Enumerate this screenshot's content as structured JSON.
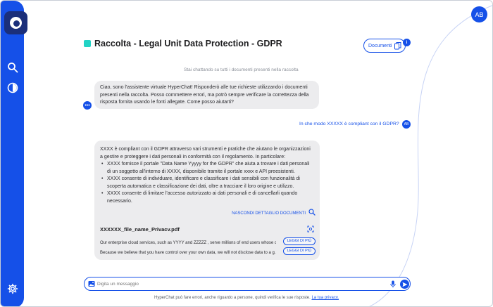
{
  "user": {
    "initials": "AB",
    "initials_small": "AB"
  },
  "header": {
    "title": "Raccolta - Legal Unit Data Protection - GDPR",
    "documents_button": "Documenti",
    "info_badge": "i"
  },
  "chat": {
    "context_info": "Stai chattando su tutti i documenti presenti nella raccolta",
    "assistant_greeting": "Ciao, sono l'assistente virtuale HyperChat! Risponderò alle tue richieste utilizzando i documenti presenti nella raccolta. Posso commettere errori, ma potrò sempre verificare la correttezza della risposta fornita usando le fonti allegate. Come posso aiutarti?",
    "assistant_more": "•••",
    "user_question": "In che modo XXXXX è compliant con il GDPR?",
    "answer": {
      "intro": "XXXX è compliant con il GDPR attraverso vari strumenti e pratiche che aiutano le organizzazioni a gestire e proteggere i dati personali in conformità con il regolamento. In particolare:",
      "bullets": [
        "XXXX fornisce il portale \"Data Name Yyyyy for the GDPR\" che aiuta a trovare i dati personali di un soggetto all'interno di XXXX, disponibile tramite il portale xxxx e API preesistenti.",
        "XXXX consente di individuare, identificare e classificare i dati sensibili con funzionalità di scoperta automatica e classificazione dei dati, oltre a tracciare il loro origine e utilizzo.",
        "XXXX consente di limitare l'accesso autorizzato ai dati personali e di cancellarli quando necessario."
      ],
      "hide_details": "NASCONDI DETTAGLIO DOCUMENTI",
      "file_name": "XXXXXX_file_name_Privacv.pdf",
      "snippets": [
        {
          "text": "Our enterprise cloud services, such as YYYY and ZZZZZ , serve millions of end users whose c...",
          "button": "LEGGI DI PIÙ"
        },
        {
          "text": "Because we believe that you have control over your own data, we will not disclose data to a g...",
          "button": "LEGGI DI PIÙ"
        }
      ]
    }
  },
  "input": {
    "placeholder": "Digita un messaggio"
  },
  "footer": {
    "disclaimer": "HyperChat può fare errori, anche riguardo a persone, quindi verifica le sue risposte.",
    "privacy_link": "La tua privacy."
  },
  "colors": {
    "primary": "#1550e8",
    "accent": "#22d3c5",
    "bubble": "#ececee"
  }
}
